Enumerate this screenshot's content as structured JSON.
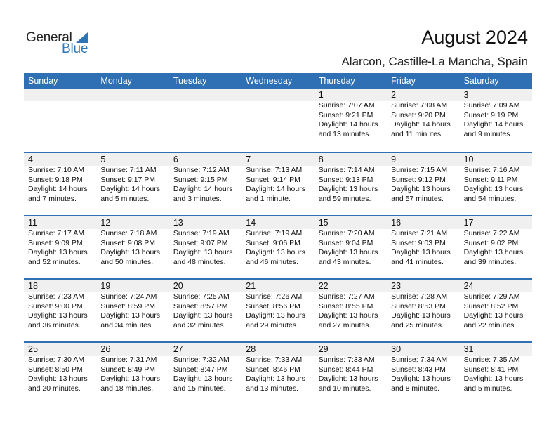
{
  "logo": {
    "line1": "General",
    "line2": "Blue",
    "icon": "triangle-flag-icon"
  },
  "header": {
    "title": "August 2024",
    "location": "Alarcon, Castille-La Mancha, Spain"
  },
  "colors": {
    "accent": "#2e70b3",
    "daynum_bg": "#f0f0f0",
    "logo_blue": "#2e75b6"
  },
  "weekdays": [
    "Sunday",
    "Monday",
    "Tuesday",
    "Wednesday",
    "Thursday",
    "Friday",
    "Saturday"
  ],
  "weeks": [
    [
      null,
      null,
      null,
      null,
      {
        "day": "1",
        "sunrise": "Sunrise: 7:07 AM",
        "sunset": "Sunset: 9:21 PM",
        "daylight1": "Daylight: 14 hours",
        "daylight2": "and 13 minutes."
      },
      {
        "day": "2",
        "sunrise": "Sunrise: 7:08 AM",
        "sunset": "Sunset: 9:20 PM",
        "daylight1": "Daylight: 14 hours",
        "daylight2": "and 11 minutes."
      },
      {
        "day": "3",
        "sunrise": "Sunrise: 7:09 AM",
        "sunset": "Sunset: 9:19 PM",
        "daylight1": "Daylight: 14 hours",
        "daylight2": "and 9 minutes."
      }
    ],
    [
      {
        "day": "4",
        "sunrise": "Sunrise: 7:10 AM",
        "sunset": "Sunset: 9:18 PM",
        "daylight1": "Daylight: 14 hours",
        "daylight2": "and 7 minutes."
      },
      {
        "day": "5",
        "sunrise": "Sunrise: 7:11 AM",
        "sunset": "Sunset: 9:17 PM",
        "daylight1": "Daylight: 14 hours",
        "daylight2": "and 5 minutes."
      },
      {
        "day": "6",
        "sunrise": "Sunrise: 7:12 AM",
        "sunset": "Sunset: 9:15 PM",
        "daylight1": "Daylight: 14 hours",
        "daylight2": "and 3 minutes."
      },
      {
        "day": "7",
        "sunrise": "Sunrise: 7:13 AM",
        "sunset": "Sunset: 9:14 PM",
        "daylight1": "Daylight: 14 hours",
        "daylight2": "and 1 minute."
      },
      {
        "day": "8",
        "sunrise": "Sunrise: 7:14 AM",
        "sunset": "Sunset: 9:13 PM",
        "daylight1": "Daylight: 13 hours",
        "daylight2": "and 59 minutes."
      },
      {
        "day": "9",
        "sunrise": "Sunrise: 7:15 AM",
        "sunset": "Sunset: 9:12 PM",
        "daylight1": "Daylight: 13 hours",
        "daylight2": "and 57 minutes."
      },
      {
        "day": "10",
        "sunrise": "Sunrise: 7:16 AM",
        "sunset": "Sunset: 9:11 PM",
        "daylight1": "Daylight: 13 hours",
        "daylight2": "and 54 minutes."
      }
    ],
    [
      {
        "day": "11",
        "sunrise": "Sunrise: 7:17 AM",
        "sunset": "Sunset: 9:09 PM",
        "daylight1": "Daylight: 13 hours",
        "daylight2": "and 52 minutes."
      },
      {
        "day": "12",
        "sunrise": "Sunrise: 7:18 AM",
        "sunset": "Sunset: 9:08 PM",
        "daylight1": "Daylight: 13 hours",
        "daylight2": "and 50 minutes."
      },
      {
        "day": "13",
        "sunrise": "Sunrise: 7:19 AM",
        "sunset": "Sunset: 9:07 PM",
        "daylight1": "Daylight: 13 hours",
        "daylight2": "and 48 minutes."
      },
      {
        "day": "14",
        "sunrise": "Sunrise: 7:19 AM",
        "sunset": "Sunset: 9:06 PM",
        "daylight1": "Daylight: 13 hours",
        "daylight2": "and 46 minutes."
      },
      {
        "day": "15",
        "sunrise": "Sunrise: 7:20 AM",
        "sunset": "Sunset: 9:04 PM",
        "daylight1": "Daylight: 13 hours",
        "daylight2": "and 43 minutes."
      },
      {
        "day": "16",
        "sunrise": "Sunrise: 7:21 AM",
        "sunset": "Sunset: 9:03 PM",
        "daylight1": "Daylight: 13 hours",
        "daylight2": "and 41 minutes."
      },
      {
        "day": "17",
        "sunrise": "Sunrise: 7:22 AM",
        "sunset": "Sunset: 9:02 PM",
        "daylight1": "Daylight: 13 hours",
        "daylight2": "and 39 minutes."
      }
    ],
    [
      {
        "day": "18",
        "sunrise": "Sunrise: 7:23 AM",
        "sunset": "Sunset: 9:00 PM",
        "daylight1": "Daylight: 13 hours",
        "daylight2": "and 36 minutes."
      },
      {
        "day": "19",
        "sunrise": "Sunrise: 7:24 AM",
        "sunset": "Sunset: 8:59 PM",
        "daylight1": "Daylight: 13 hours",
        "daylight2": "and 34 minutes."
      },
      {
        "day": "20",
        "sunrise": "Sunrise: 7:25 AM",
        "sunset": "Sunset: 8:57 PM",
        "daylight1": "Daylight: 13 hours",
        "daylight2": "and 32 minutes."
      },
      {
        "day": "21",
        "sunrise": "Sunrise: 7:26 AM",
        "sunset": "Sunset: 8:56 PM",
        "daylight1": "Daylight: 13 hours",
        "daylight2": "and 29 minutes."
      },
      {
        "day": "22",
        "sunrise": "Sunrise: 7:27 AM",
        "sunset": "Sunset: 8:55 PM",
        "daylight1": "Daylight: 13 hours",
        "daylight2": "and 27 minutes."
      },
      {
        "day": "23",
        "sunrise": "Sunrise: 7:28 AM",
        "sunset": "Sunset: 8:53 PM",
        "daylight1": "Daylight: 13 hours",
        "daylight2": "and 25 minutes."
      },
      {
        "day": "24",
        "sunrise": "Sunrise: 7:29 AM",
        "sunset": "Sunset: 8:52 PM",
        "daylight1": "Daylight: 13 hours",
        "daylight2": "and 22 minutes."
      }
    ],
    [
      {
        "day": "25",
        "sunrise": "Sunrise: 7:30 AM",
        "sunset": "Sunset: 8:50 PM",
        "daylight1": "Daylight: 13 hours",
        "daylight2": "and 20 minutes."
      },
      {
        "day": "26",
        "sunrise": "Sunrise: 7:31 AM",
        "sunset": "Sunset: 8:49 PM",
        "daylight1": "Daylight: 13 hours",
        "daylight2": "and 18 minutes."
      },
      {
        "day": "27",
        "sunrise": "Sunrise: 7:32 AM",
        "sunset": "Sunset: 8:47 PM",
        "daylight1": "Daylight: 13 hours",
        "daylight2": "and 15 minutes."
      },
      {
        "day": "28",
        "sunrise": "Sunrise: 7:33 AM",
        "sunset": "Sunset: 8:46 PM",
        "daylight1": "Daylight: 13 hours",
        "daylight2": "and 13 minutes."
      },
      {
        "day": "29",
        "sunrise": "Sunrise: 7:33 AM",
        "sunset": "Sunset: 8:44 PM",
        "daylight1": "Daylight: 13 hours",
        "daylight2": "and 10 minutes."
      },
      {
        "day": "30",
        "sunrise": "Sunrise: 7:34 AM",
        "sunset": "Sunset: 8:43 PM",
        "daylight1": "Daylight: 13 hours",
        "daylight2": "and 8 minutes."
      },
      {
        "day": "31",
        "sunrise": "Sunrise: 7:35 AM",
        "sunset": "Sunset: 8:41 PM",
        "daylight1": "Daylight: 13 hours",
        "daylight2": "and 5 minutes."
      }
    ]
  ]
}
